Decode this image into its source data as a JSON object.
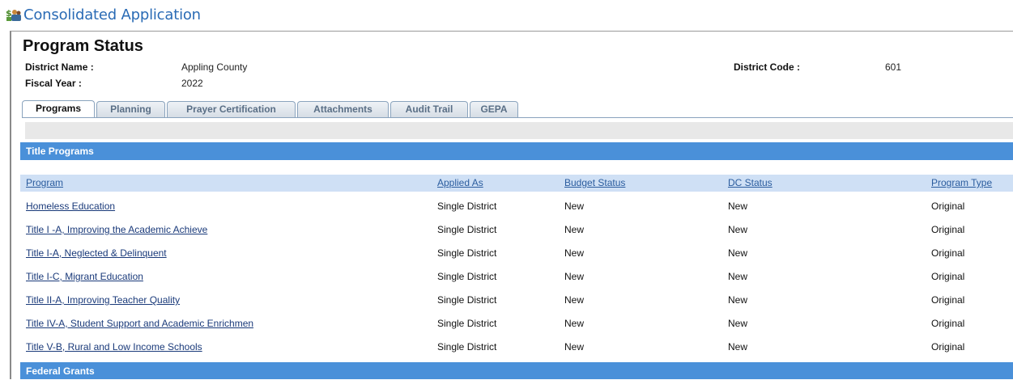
{
  "app": {
    "title": "Consolidated Application",
    "logo_icon": "money-people-icon"
  },
  "page": {
    "title": "Program Status",
    "district_name_label": "District Name :",
    "district_name": "Appling County",
    "fiscal_year_label": "Fiscal Year :",
    "fiscal_year": "2022",
    "district_code_label": "District Code :",
    "district_code": "601"
  },
  "tabs": [
    {
      "label": "Programs",
      "active": true
    },
    {
      "label": "Planning",
      "active": false
    },
    {
      "label": "Prayer Certification",
      "active": false
    },
    {
      "label": "Attachments",
      "active": false
    },
    {
      "label": "Audit Trail",
      "active": false
    },
    {
      "label": "GEPA",
      "active": false
    }
  ],
  "sections": {
    "title_programs": "Title Programs",
    "federal_grants": "Federal Grants"
  },
  "columns": {
    "program": "Program",
    "applied_as": "Applied As",
    "budget_status": "Budget Status",
    "dc_status": "DC Status",
    "program_type": "Program Type"
  },
  "rows": [
    {
      "program": "Homeless Education",
      "applied_as": "Single District",
      "budget_status": "New",
      "dc_status": "New",
      "program_type": "Original"
    },
    {
      "program": "Title I -A, Improving the Academic Achieve",
      "applied_as": "Single District",
      "budget_status": "New",
      "dc_status": "New",
      "program_type": "Original"
    },
    {
      "program": "Title I-A, Neglected & Delinquent",
      "applied_as": "Single District",
      "budget_status": "New",
      "dc_status": "New",
      "program_type": "Original"
    },
    {
      "program": "Title I-C, Migrant Education",
      "applied_as": "Single District",
      "budget_status": "New",
      "dc_status": "New",
      "program_type": "Original"
    },
    {
      "program": "Title II-A, Improving Teacher Quality",
      "applied_as": "Single District",
      "budget_status": "New",
      "dc_status": "New",
      "program_type": "Original"
    },
    {
      "program": "Title IV-A, Student Support and Academic Enrichmen",
      "applied_as": "Single District",
      "budget_status": "New",
      "dc_status": "New",
      "program_type": "Original"
    },
    {
      "program": "Title V-B, Rural and Low Income Schools",
      "applied_as": "Single District",
      "budget_status": "New",
      "dc_status": "New",
      "program_type": "Original"
    }
  ],
  "colors": {
    "accent": "#4a90d9",
    "header_row": "#cfe0f5",
    "title_text": "#2a6bb5"
  }
}
